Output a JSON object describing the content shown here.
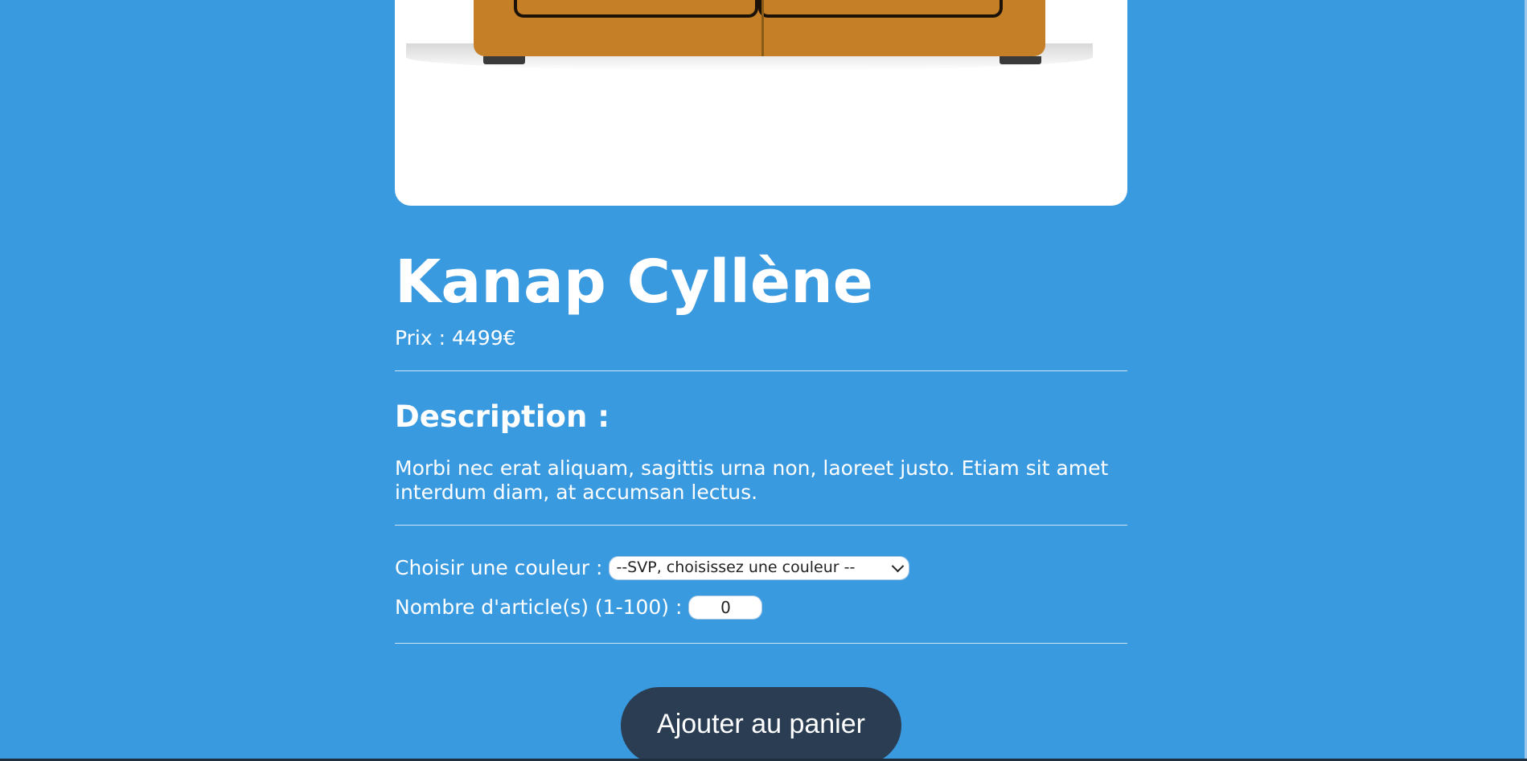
{
  "product": {
    "title": "Kanap Cyllène",
    "price_label": "Prix : 4499€",
    "description_title": "Description :",
    "description_text": "Morbi nec erat aliquam, sagittis urna non, laoreet justo. Etiam sit amet interdum diam, at accumsan lectus."
  },
  "options": {
    "color_label": "Choisir une couleur :",
    "color_selected": "--SVP, choisissez une couleur --",
    "quantity_label": "Nombre d'article(s) (1-100) :",
    "quantity_value": "0"
  },
  "cart": {
    "add_label": "Ajouter au panier"
  },
  "colors": {
    "background": "#3a9ae0",
    "button": "#2b3d53",
    "sofa": "#c47f27"
  }
}
